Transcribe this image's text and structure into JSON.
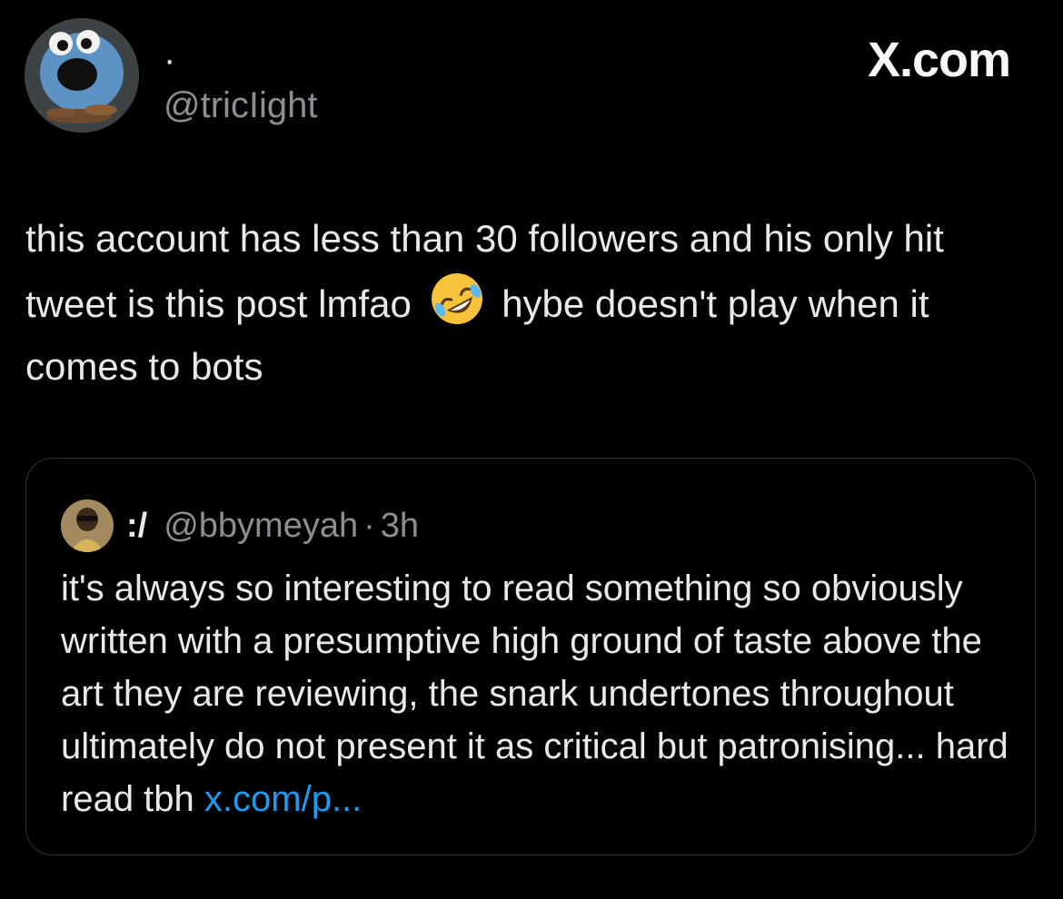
{
  "header": {
    "display_name": "·",
    "handle": "@tricIight",
    "brand": "X.com"
  },
  "tweet": {
    "text_part1": "this account has less than 30 followers and his only hit tweet is this post lmfao",
    "emoji": "rolling-on-floor-laughing-emoji",
    "text_part2": "hybe doesn't play when it comes to bots"
  },
  "quoted_tweet": {
    "display_name": ":/",
    "handle": "@bbymeyah",
    "separator": "·",
    "time": "3h",
    "text": "it's always so interesting to read something so obviously written with a presumptive high ground of taste above the art they are reviewing, the snark undertones throughout ultimately do not present it as critical but patronising... hard read tbh",
    "link": "x.com/p..."
  },
  "colors": {
    "background": "#000000",
    "text": "#e7e9ea",
    "secondary_text": "#8b8f94",
    "link": "#1d9bf0",
    "border": "#2f3336"
  }
}
